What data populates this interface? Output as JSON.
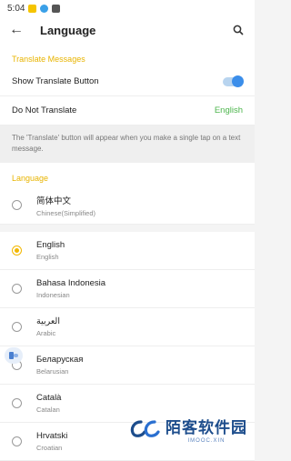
{
  "status_bar": {
    "time": "5:04"
  },
  "header": {
    "title": "Language"
  },
  "translate_section": {
    "heading": "Translate Messages",
    "show_translate_label": "Show Translate Button",
    "show_translate_on": true,
    "do_not_translate_label": "Do Not Translate",
    "do_not_translate_value": "English",
    "note": "The 'Translate' button will appear when you make a single tap on a text message."
  },
  "language_section": {
    "heading": "Language",
    "items": [
      {
        "name": "简体中文",
        "sub": "Chinese(Simplified)",
        "selected": false
      },
      {
        "name": "English",
        "sub": "English",
        "selected": true
      },
      {
        "name": "Bahasa Indonesia",
        "sub": "Indonesian",
        "selected": false
      },
      {
        "name": "العربية",
        "sub": "Arabic",
        "selected": false
      },
      {
        "name": "Беларуская",
        "sub": "Belarusian",
        "selected": false
      },
      {
        "name": "Català",
        "sub": "Catalan",
        "selected": false
      },
      {
        "name": "Hrvatski",
        "sub": "Croatian",
        "selected": false
      }
    ]
  },
  "watermark": {
    "main": "陌客软件园",
    "sub": "IMOOC.XIN"
  },
  "colors": {
    "accent": "#f2b701",
    "green": "#4cb54c",
    "toggle": "#3b8eea"
  }
}
